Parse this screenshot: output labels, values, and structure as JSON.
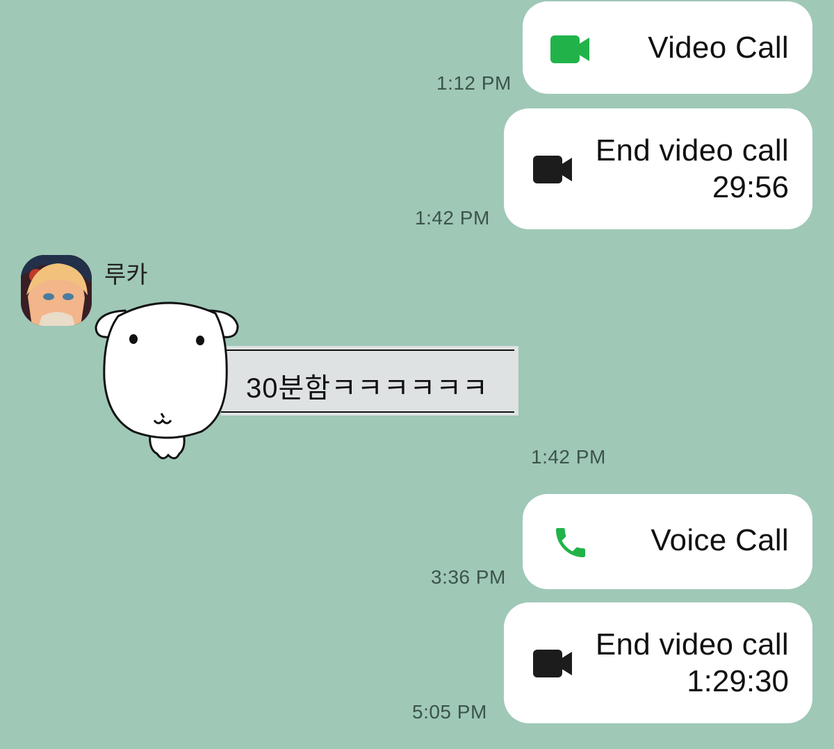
{
  "messages": [
    {
      "type": "call",
      "icon": "video-camera-icon",
      "icon_color": "#21b34a",
      "title": "Video Call",
      "time": "1:12 PM"
    },
    {
      "type": "call",
      "icon": "video-camera-icon",
      "icon_color": "#1c1c1c",
      "title": "End video call",
      "duration": "29:56",
      "time": "1:42 PM"
    },
    {
      "type": "sticker",
      "sender": "루카",
      "text": "30분함ㅋㅋㅋㅋㅋㅋ",
      "time": "1:42 PM"
    },
    {
      "type": "call",
      "icon": "phone-icon",
      "icon_color": "#21b34a",
      "title": "Voice Call",
      "time": "3:36 PM"
    },
    {
      "type": "call",
      "icon": "video-camera-icon",
      "icon_color": "#1c1c1c",
      "title": "End video call",
      "duration": "1:29:30",
      "time": "5:05 PM"
    }
  ],
  "colors": {
    "background": "#9fc8b7",
    "bubble": "#ffffff",
    "call_green": "#21b34a",
    "icon_dark": "#1c1c1c"
  }
}
